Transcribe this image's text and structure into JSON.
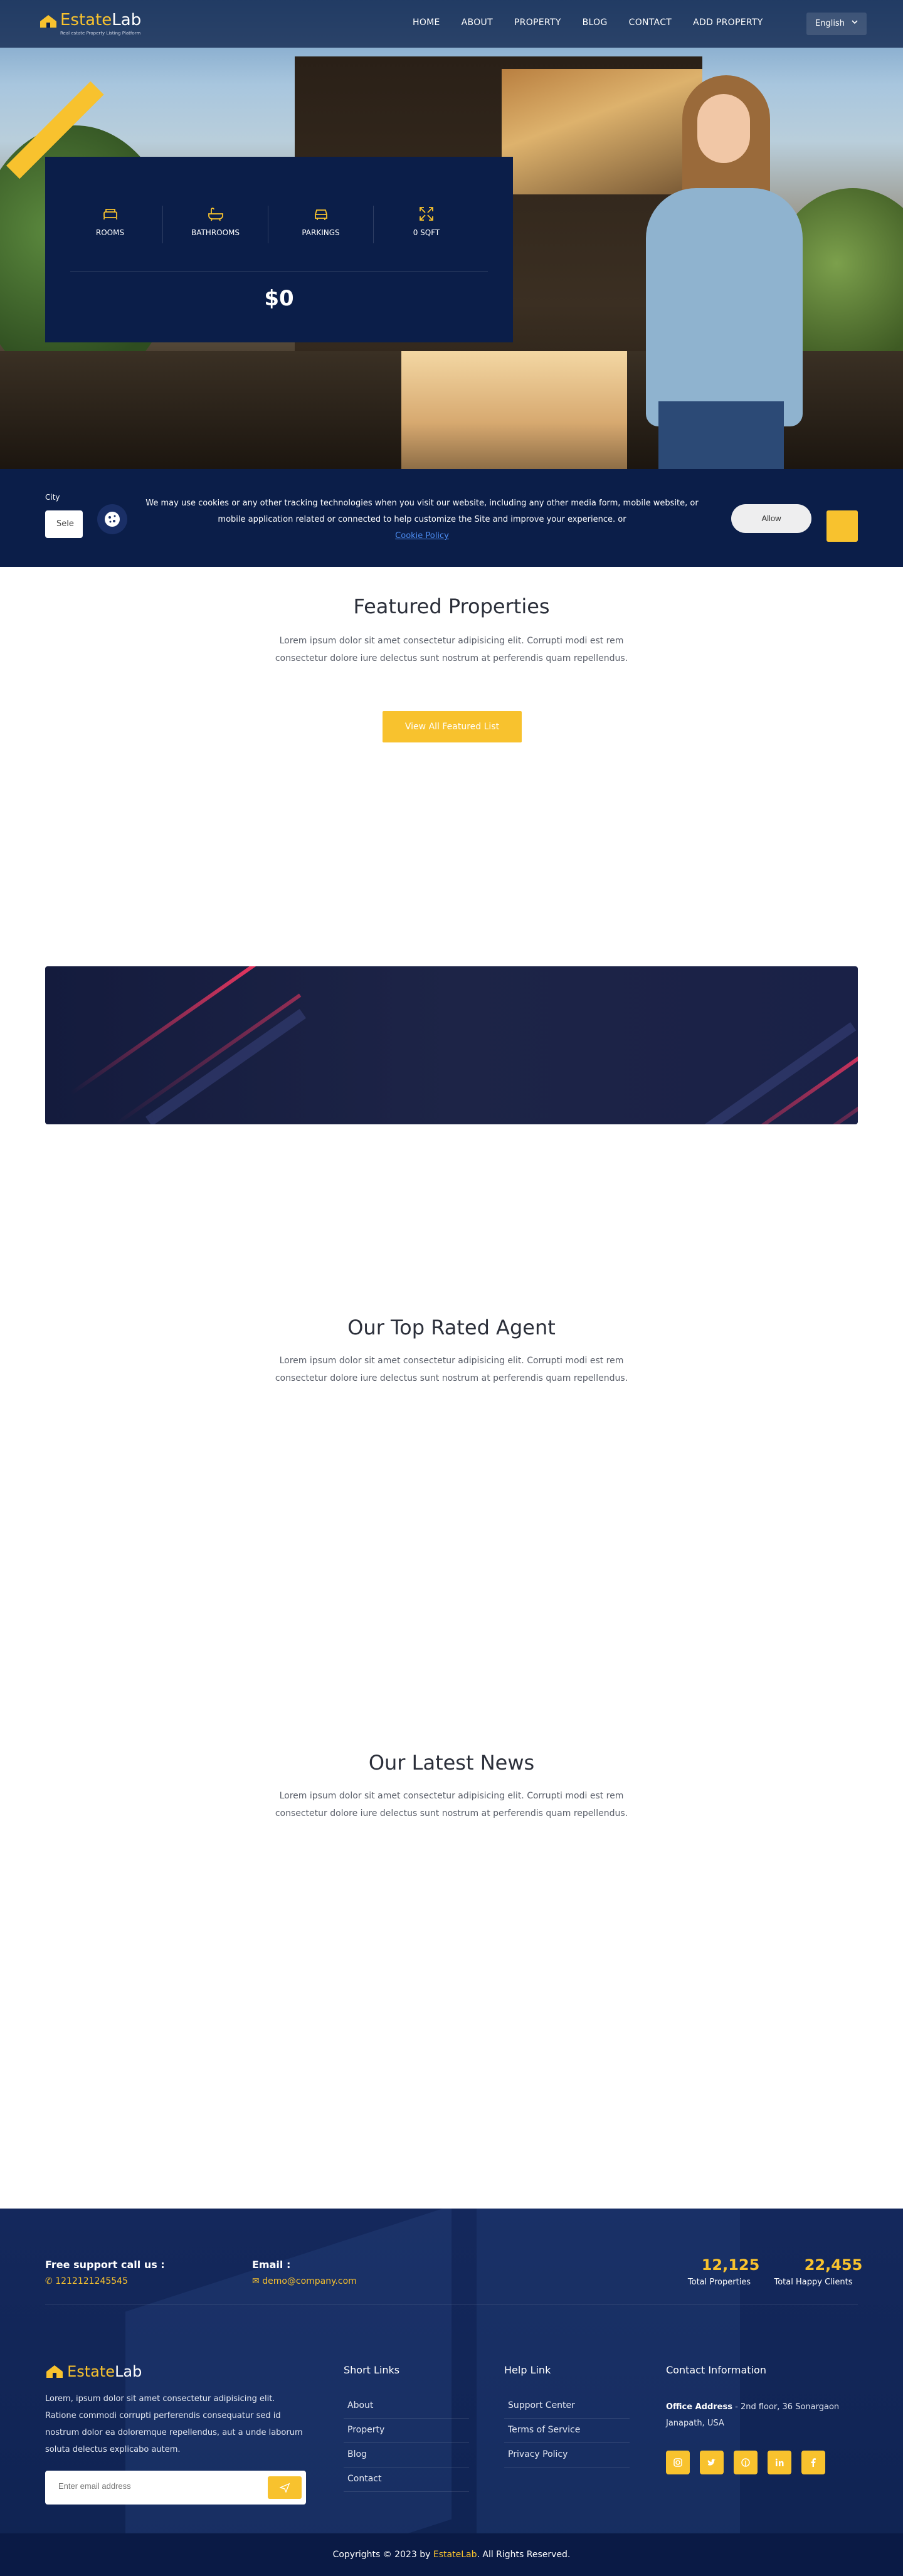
{
  "header": {
    "logo_primary": "Estate",
    "logo_secondary": "Lab",
    "logo_tagline": "Real estate Property Listing Platform",
    "nav": [
      "HOME",
      "ABOUT",
      "PROPERTY",
      "BLOG",
      "CONTACT",
      "ADD PROPERTY"
    ],
    "language": "English"
  },
  "hero": {
    "ribbon_label": "",
    "features": [
      {
        "icon": "bed-icon",
        "label": "ROOMS"
      },
      {
        "icon": "bathtub-icon",
        "label": "BATHROOMS"
      },
      {
        "icon": "car-icon",
        "label": "PARKINGS"
      },
      {
        "icon": "expand-icon",
        "label": "0 SQFT"
      }
    ],
    "price": "$0"
  },
  "cookie": {
    "city_label": "City",
    "city_select_value": "Sele",
    "message": "We may use cookies or any other tracking technologies when you visit our website, including any other media form, mobile website, or mobile application related or connected to help customize the Site and improve your experience. or",
    "policy_link": "Cookie Policy",
    "allow": "Allow"
  },
  "featured": {
    "title": "Featured Properties",
    "desc": "Lorem ipsum dolor sit amet consectetur adipisicing elit. Corrupti modi est rem consectetur dolore iure delectus sunt nostrum at perferendis quam repellendus.",
    "button": "View All Featured List"
  },
  "agents": {
    "title": "Our Top Rated Agent",
    "desc": "Lorem ipsum dolor sit amet consectetur adipisicing elit. Corrupti modi est rem consectetur dolore iure delectus sunt nostrum at perferendis quam repellendus."
  },
  "news": {
    "title": "Our Latest News",
    "desc": "Lorem ipsum dolor sit amet consectetur adipisicing elit. Corrupti modi est rem consectetur dolore iure delectus sunt nostrum at perferendis quam repellendus."
  },
  "footer": {
    "support_label": "Free support call us :",
    "support_phone": "1212121245545",
    "email_label": "Email :",
    "email_value": "demo@company.com",
    "stats": [
      {
        "value": "12,125",
        "label": "Total Properties"
      },
      {
        "value": "22,455",
        "label": "Total Happy Clients"
      }
    ],
    "about_text": "Lorem, ipsum dolor sit amet consectetur adipisicing elit. Ratione commodi corrupti perferendis consequatur sed id nostrum dolor ea doloremque repellendus, aut a unde laborum soluta delectus explicabo autem.",
    "subscribe_placeholder": "Enter email address",
    "short_links_title": "Short Links",
    "short_links": [
      "About",
      "Property",
      "Blog",
      "Contact"
    ],
    "help_title": "Help Link",
    "help_links": [
      "Support Center",
      "Terms of Service",
      "Privacy Policy"
    ],
    "contact_title": "Contact Information",
    "office_label": "Office Address",
    "office_value": " - 2nd floor, 36 Sonargaon Janapath, USA",
    "socials": [
      "instagram-icon",
      "twitter-icon",
      "pinterest-icon",
      "linkedin-icon",
      "facebook-icon"
    ],
    "copyright_prefix": "Copyrights © 2023 by ",
    "copyright_brand": "EstateLab",
    "copyright_suffix": ". All Rights Reserved."
  },
  "colors": {
    "accent": "#f8c22e",
    "navy": "#0b1e49",
    "link": "#4d8df2"
  }
}
